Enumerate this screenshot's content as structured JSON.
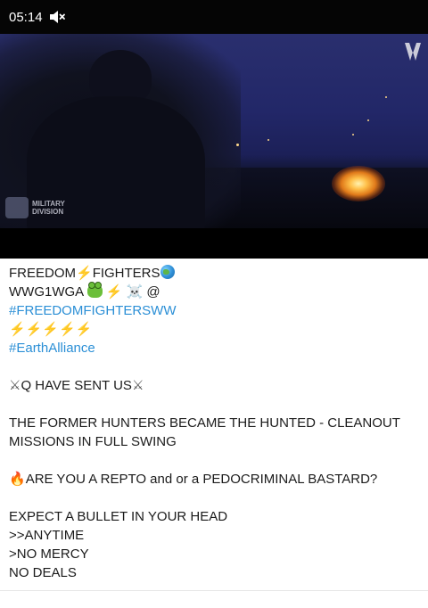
{
  "player": {
    "time": "05:14",
    "watermark": {
      "line1": "MILITARY",
      "line2": "DIVISION"
    }
  },
  "post": {
    "line1_a": "FREEDOM",
    "line1_b": "FIGHTERS",
    "line2_a": "WWG1WGA",
    "line2_b": "@",
    "hashtag1": "#FREEDOMFIGHTERSWW",
    "bolts": "⚡⚡⚡⚡⚡",
    "hashtag2": "#EarthAlliance",
    "q_line": "Q HAVE SENT US",
    "hunters": "THE FORMER HUNTERS BECAME THE HUNTED - CLEANOUT MISSIONS IN FULL SWING",
    "repto": "ARE YOU A REPTO and or a PEDOCRIMINAL BASTARD?",
    "expect": "EXPECT A BULLET IN YOUR HEAD",
    "anytime": ">>ANYTIME",
    "no_mercy": ">NO MERCY",
    "no_deals": "NO DEALS"
  },
  "icons": {
    "bolt": "⚡",
    "skull": "☠️",
    "swords": "⚔",
    "fire": "🔥"
  }
}
